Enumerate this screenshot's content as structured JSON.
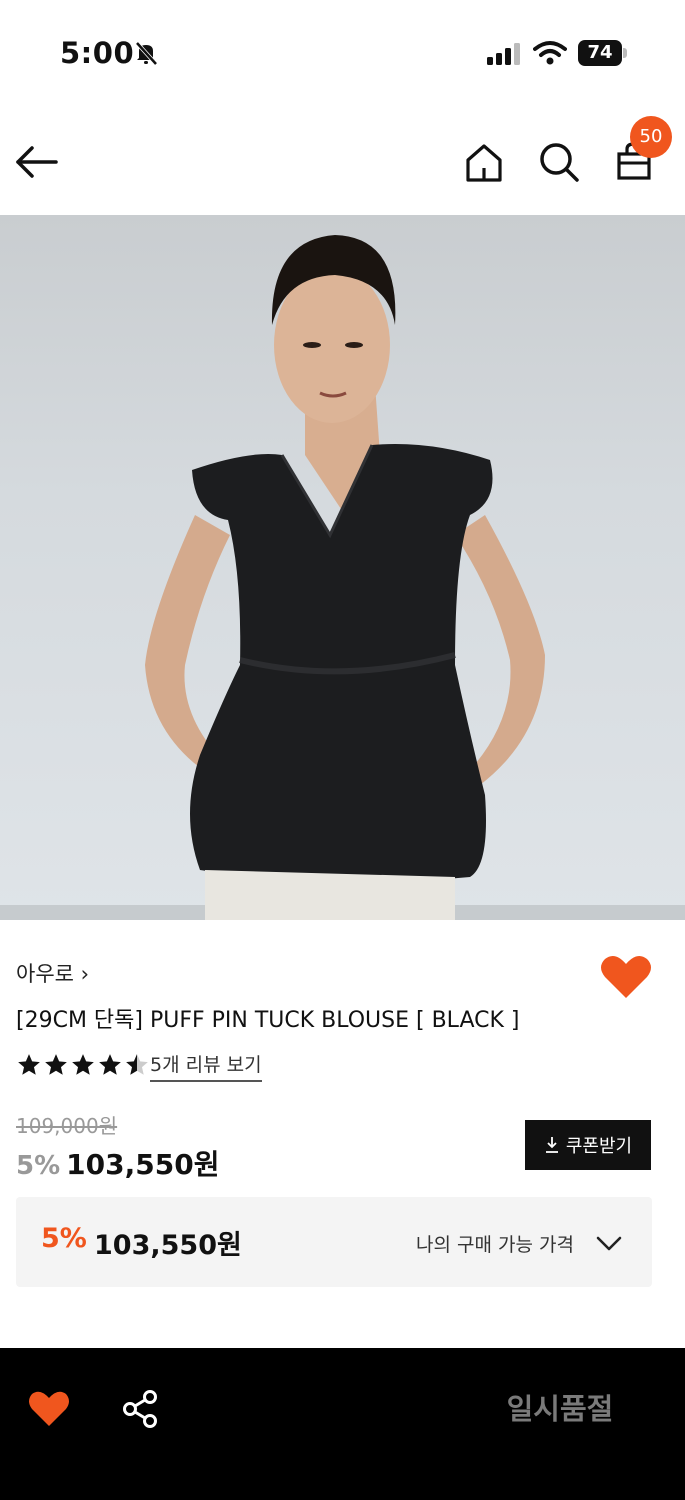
{
  "status_bar": {
    "time": "5:00",
    "battery": "74"
  },
  "header": {
    "cart_count": "50"
  },
  "product": {
    "brand": "아우로 ›",
    "title": "[29CM 단독] PUFF PIN TUCK BLOUSE [ BLACK ]",
    "rating": 4.5,
    "review_link": "5개 리뷰 보기",
    "original_price": "109,000원",
    "discount_percent": "5%",
    "sale_price": "103,550원",
    "coupon_button": "쿠폰받기"
  },
  "my_price": {
    "discount_percent": "5%",
    "amount": "103,550원",
    "label": "나의 구매 가능 가격"
  },
  "bottom_bar": {
    "soldout_label": "일시품절"
  },
  "colors": {
    "accent": "#f0561e",
    "bar_bg": "#000000",
    "muted": "#999999"
  }
}
